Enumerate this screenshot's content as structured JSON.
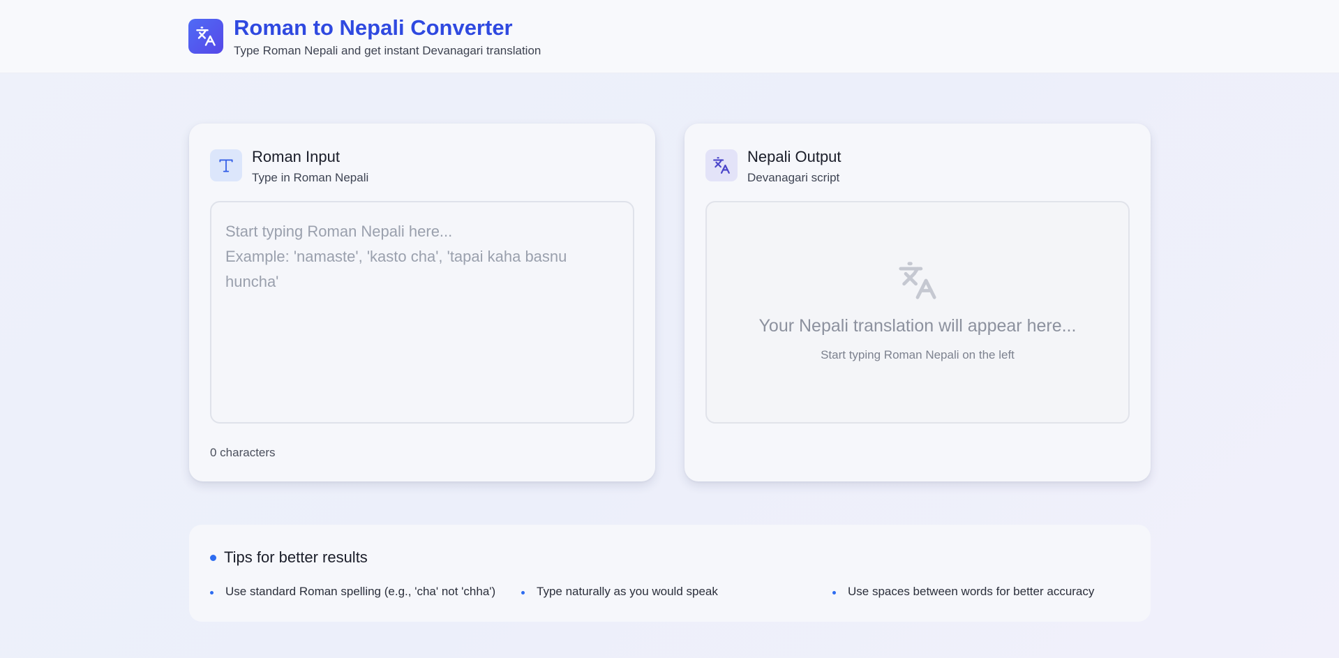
{
  "header": {
    "title": "Roman to Nepali Converter",
    "subtitle": "Type Roman Nepali and get instant Devanagari translation",
    "logo_icon": "translate-icon"
  },
  "input_card": {
    "icon": "text-T-icon",
    "title": "Roman Input",
    "subtitle": "Type in Roman Nepali",
    "value": "",
    "placeholder": "Start typing Roman Nepali here...\nExample: 'namaste', 'kasto cha', 'tapai kaha basnu huncha'",
    "char_count": "0 characters"
  },
  "output_card": {
    "icon": "translate-icon",
    "title": "Nepali Output",
    "subtitle": "Devanagari script",
    "placeholder_icon": "translate-icon",
    "placeholder": "Your Nepali translation will appear here...",
    "hint": "Start typing Roman Nepali on the left"
  },
  "tips": {
    "title": "Tips for better results",
    "items": [
      "Use standard Roman spelling (e.g., 'cha' not 'chha')",
      "Type naturally as you would speak",
      "Use spaces between words for better accuracy"
    ]
  },
  "colors": {
    "accent": "#2f49e0",
    "logo_gradient_start": "#4f6bf5",
    "logo_gradient_end": "#5648e8",
    "bullet": "#2d6cf0"
  }
}
